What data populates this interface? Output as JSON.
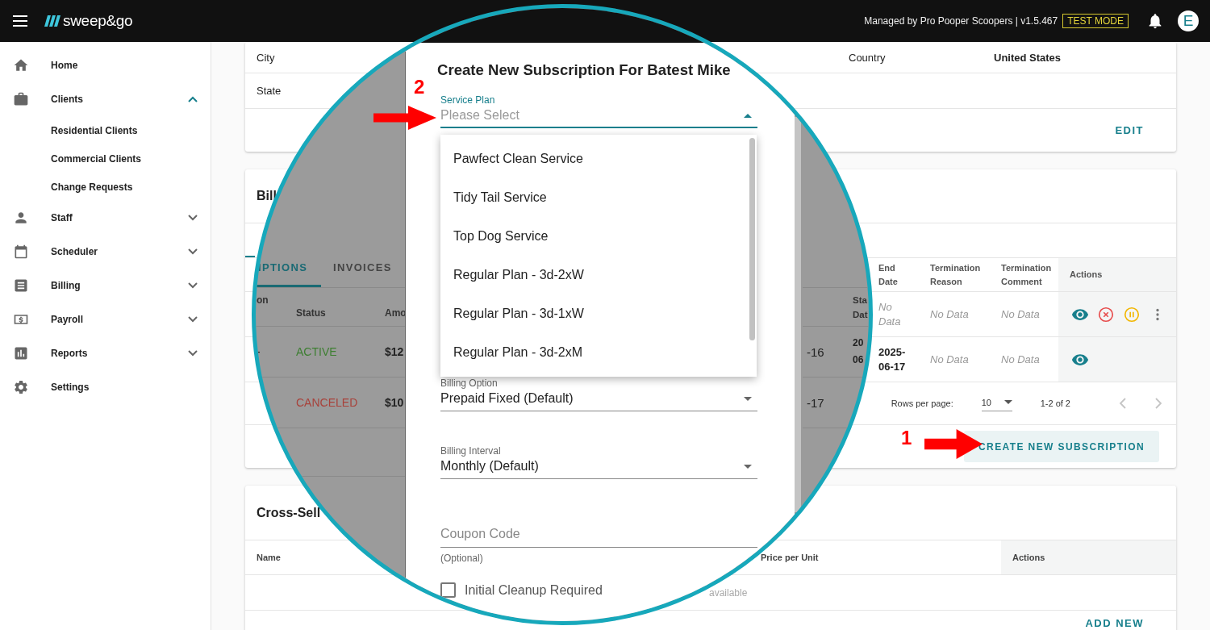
{
  "header": {
    "brand": "sweep&go",
    "managed_by": "Managed by Pro Pooper Scoopers | v1.5.467",
    "mode_badge": "TEST MODE",
    "avatar": "E"
  },
  "sidebar": {
    "items": [
      {
        "label": "Home"
      },
      {
        "label": "Clients",
        "expanded": true,
        "children": [
          {
            "label": "Residential Clients"
          },
          {
            "label": "Commercial Clients"
          },
          {
            "label": "Change Requests"
          }
        ]
      },
      {
        "label": "Staff",
        "expanded": false
      },
      {
        "label": "Scheduler",
        "expanded": false
      },
      {
        "label": "Billing",
        "expanded": false
      },
      {
        "label": "Payroll",
        "expanded": false
      },
      {
        "label": "Reports",
        "expanded": false
      },
      {
        "label": "Settings"
      }
    ]
  },
  "address_card": {
    "rows": [
      {
        "label": "City",
        "extra_label": "Country",
        "extra_value": "United States"
      },
      {
        "label": "State"
      }
    ],
    "action": "EDIT"
  },
  "billing_card": {
    "title": "Bill",
    "tabs": [
      {
        "selected": true
      }
    ],
    "table": {
      "columns": [
        "End Date",
        "Termination Reason",
        "Termination Comment",
        "Actions"
      ],
      "rows": [
        {
          "cells": [
            {
              "text": "No Data",
              "empty": true
            },
            {
              "text": "No Data",
              "empty": true
            },
            {
              "text": "No Data",
              "empty": true
            }
          ],
          "actions": [
            {
              "kind": "view"
            },
            {
              "kind": "cancel"
            },
            {
              "kind": "pause"
            },
            {
              "kind": "more"
            }
          ]
        },
        {
          "cells": [
            {
              "text": "2025-06-17",
              "empty": false
            },
            {
              "text": "No Data",
              "empty": true
            },
            {
              "text": "No Data",
              "empty": true
            }
          ],
          "actions": [
            {
              "kind": "view"
            }
          ]
        }
      ]
    },
    "pagination": {
      "label": "Rows per page:",
      "rows_per_page": "10",
      "range": "1-2 of 2",
      "prev_disabled": true,
      "next_disabled": true
    },
    "primary_action": "CREATE NEW SUBSCRIPTION"
  },
  "cross_sell_card": {
    "title": "Cross-Sell",
    "columns": [
      "Name",
      "Price per Unit",
      "Actions"
    ],
    "empty_message": "available",
    "action": "ADD NEW"
  },
  "magnifier": {
    "left_fragment": {
      "tabs": [
        {
          "label": "IPTIONS",
          "selected": true
        },
        {
          "label": "INVOICES",
          "selected": false
        }
      ],
      "columns": [
        "on",
        "Status",
        "Amo"
      ],
      "rows": [
        {
          "lead": "-",
          "status": "ACTIVE",
          "color": "#3e7f32",
          "amount": "$12"
        },
        {
          "status": "CANCELED",
          "color": "#a8423b",
          "amount": "$10"
        }
      ]
    },
    "right_fragment": {
      "header": "Sta Dat",
      "rows": [
        {
          "date_tail": "-16",
          "start": "20 06"
        },
        {
          "date_tail": "-17"
        }
      ]
    },
    "dialog": {
      "title": "Create New Subscription For Batest Mike",
      "fields": [
        {
          "kind": "select",
          "label": "Service Plan",
          "placeholder": "Please Select",
          "open": true,
          "options": [
            "Pawfect Clean Service",
            "Tidy Tail Service",
            "Top Dog Service",
            "Regular Plan - 3d-2xW",
            "Regular Plan - 3d-1xW",
            "Regular Plan - 3d-2xM"
          ]
        },
        {
          "kind": "select",
          "label": "Billing Option",
          "value": "Prepaid Fixed (Default)",
          "open": false
        },
        {
          "kind": "select",
          "label": "Billing Interval",
          "value": "Monthly (Default)",
          "open": false
        },
        {
          "kind": "text",
          "placeholder": "Coupon Code",
          "hint": "(Optional)"
        },
        {
          "kind": "checkbox",
          "label": "Initial Cleanup Required",
          "checked": false
        }
      ]
    }
  },
  "annotations": [
    {
      "number": "2"
    },
    {
      "number": "1"
    }
  ]
}
